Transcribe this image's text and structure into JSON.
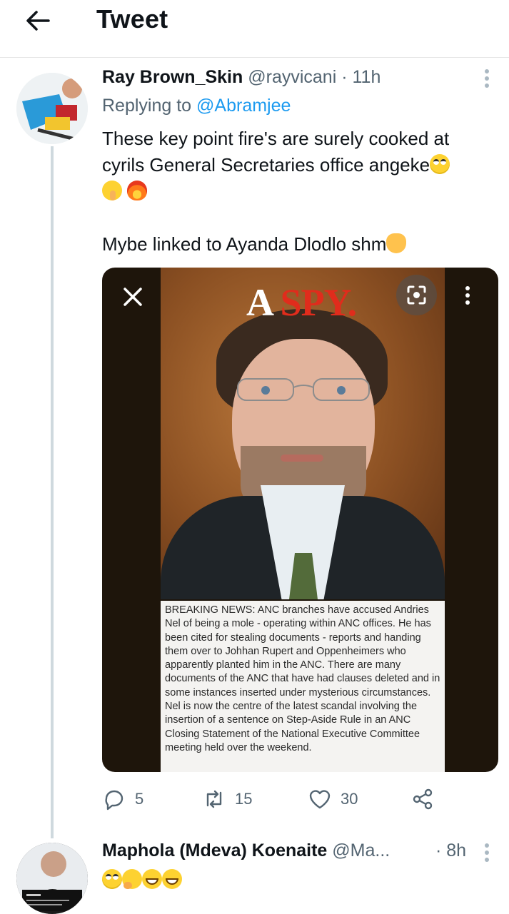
{
  "header": {
    "title": "Tweet"
  },
  "tweet1": {
    "name": "Ray Brown_Skin",
    "handle": "@rayvicani",
    "dot": "·",
    "time": "11h",
    "reply_prefix": "Replying to",
    "reply_mention": "@Abramjee",
    "text_line1": "These key point fire's are surely cooked at",
    "text_line2": "cyrils General Secretaries office angeke",
    "text_line3": "Mybe linked to Ayanda Dlodlo shm",
    "media": {
      "headline_a": "A ",
      "headline_spy": "SPY.",
      "caption": "BREAKING NEWS: ANC branches have accused Andries Nel of being a mole - operating within ANC offices. He has been cited for stealing documents - reports and handing them over to Johhan Rupert and Oppenheimers who apparently planted him in the ANC. There are many documents of the ANC that have had clauses deleted and in some instances inserted under mysterious circumstances. Nel is now the centre of the latest scandal involving the insertion of a sentence on Step-Aside Rule in an ANC Closing Statement of the National Executive Committee meeting held over the weekend."
    },
    "actions": {
      "replies": "5",
      "retweets": "15",
      "likes": "30"
    }
  },
  "tweet2": {
    "name": "Maphola (Mdeva) Koenaite",
    "handle": "@Ma...",
    "dot": "·",
    "time": "8h"
  },
  "icons": {
    "back": "arrow-left-icon",
    "more": "more-vertical-icon",
    "close": "close-icon",
    "scan": "lens-scan-icon",
    "reply": "reply-icon",
    "retweet": "retweet-icon",
    "like": "heart-icon",
    "share": "share-icon"
  },
  "colors": {
    "accent": "#1d9bf0",
    "secondary_text": "#536471",
    "thread_line": "#cfd9de"
  }
}
